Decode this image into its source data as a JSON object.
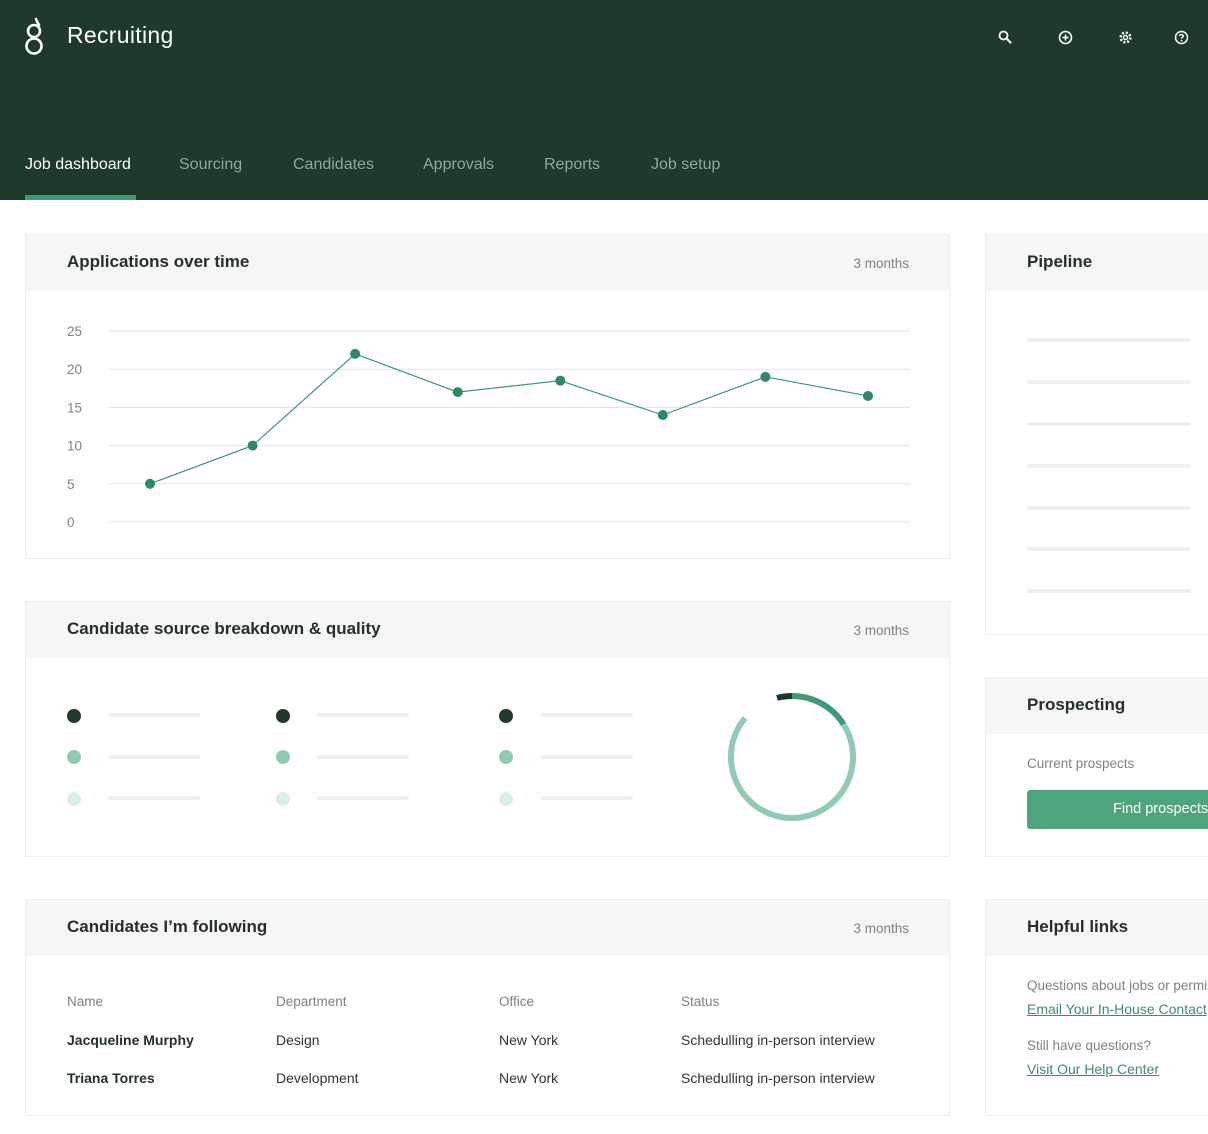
{
  "app": {
    "title": "Recruiting",
    "logo": "greenhouse-g-logo"
  },
  "header_icons": [
    "search-icon",
    "add-circle-icon",
    "gear-icon",
    "help-icon"
  ],
  "nav": {
    "tabs": [
      {
        "label": "Job dashboard",
        "active": true
      },
      {
        "label": "Sourcing",
        "active": false
      },
      {
        "label": "Candidates",
        "active": false
      },
      {
        "label": "Approvals",
        "active": false
      },
      {
        "label": "Reports",
        "active": false
      },
      {
        "label": "Job setup",
        "active": false
      }
    ]
  },
  "applications": {
    "title": "Applications over time",
    "range": "3 months",
    "chart_data": {
      "type": "line",
      "title": "Applications over time",
      "xlabel": "",
      "ylabel": "",
      "ylim": [
        0,
        25
      ],
      "yticks": [
        25,
        20,
        15,
        10,
        5,
        0
      ],
      "grid": true,
      "x": [
        1,
        2,
        3,
        4,
        5,
        6,
        7,
        8
      ],
      "series": [
        {
          "values": [
            5,
            10,
            22,
            17,
            18.5,
            14,
            19,
            16.5
          ]
        }
      ]
    }
  },
  "breakdown": {
    "title": "Candidate source breakdown & quality",
    "range": "3 months",
    "donut": {
      "shares": [
        0.1,
        0.2,
        0.7
      ]
    }
  },
  "following": {
    "title": "Candidates I’m following",
    "range": "3 months",
    "columns": [
      "Name",
      "Department",
      "Office",
      "Status"
    ],
    "rows": [
      [
        "Jacqueline Murphy",
        "Design",
        "New York",
        "Schedulling in-person interview"
      ],
      [
        "Triana Torres",
        "Development",
        "New York",
        "Schedulling in-person interview"
      ]
    ]
  },
  "pipeline": {
    "title": "Pipeline"
  },
  "prospecting": {
    "title": "Prospecting",
    "current_label": "Current prospects",
    "button_label": "Find prospects"
  },
  "helpful_links": {
    "title": "Helpful links",
    "question1": "Questions about jobs or permissions?",
    "link1": "Email Your In-House Contact",
    "question2": "Still have questions?",
    "link2": "Visit Our Help Center"
  },
  "colors": {
    "header_bg": "#1f3a2b",
    "accent": "#3d9a73",
    "button": "#4ea57d",
    "series_dark": "#1f3a2b",
    "series_mid": "#8fccb2",
    "series_light": "#d6f0e4"
  }
}
